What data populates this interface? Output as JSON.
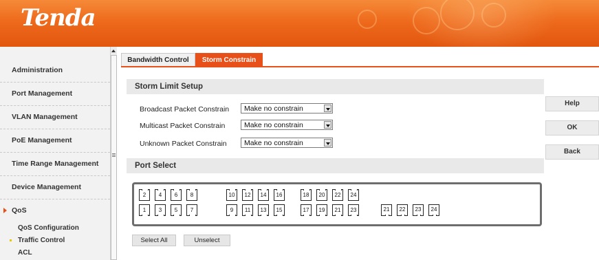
{
  "header": {
    "logo": "Tenda"
  },
  "sidebar": {
    "items": [
      {
        "label": "Administration"
      },
      {
        "label": "Port Management"
      },
      {
        "label": "VLAN Management"
      },
      {
        "label": "PoE Management"
      },
      {
        "label": "Time Range Management"
      },
      {
        "label": "Device Management"
      },
      {
        "label": "QoS"
      }
    ],
    "subitems": [
      {
        "label": "QoS Configuration"
      },
      {
        "label": "Traffic Control"
      },
      {
        "label": "ACL"
      }
    ]
  },
  "tabs": [
    {
      "label": "Bandwidth Control",
      "active": false
    },
    {
      "label": "Storm Constrain",
      "active": true
    }
  ],
  "storm": {
    "title": "Storm Limit Setup",
    "rows": [
      {
        "label": "Broadcast Packet Constrain",
        "value": "Make no constrain"
      },
      {
        "label": "Multicast Packet Constrain",
        "value": "Make no constrain"
      },
      {
        "label": "Unknown Packet Constrain",
        "value": "Make no constrain"
      }
    ]
  },
  "port_select": {
    "title": "Port Select",
    "top_row": [
      "2",
      "4",
      "6",
      "8",
      "10",
      "12",
      "14",
      "16",
      "18",
      "20",
      "22",
      "24"
    ],
    "bottom_row": [
      "1",
      "3",
      "5",
      "7",
      "9",
      "11",
      "13",
      "15",
      "17",
      "19",
      "21",
      "23"
    ],
    "fiber": [
      "21",
      "22",
      "23",
      "24"
    ],
    "select_all": "Select All",
    "unselect": "Unselect"
  },
  "actions": {
    "help": "Help",
    "ok": "OK",
    "back": "Back"
  },
  "colors": {
    "accent": "#e8501a",
    "header_start": "#f58a38",
    "header_end": "#e2560f"
  }
}
